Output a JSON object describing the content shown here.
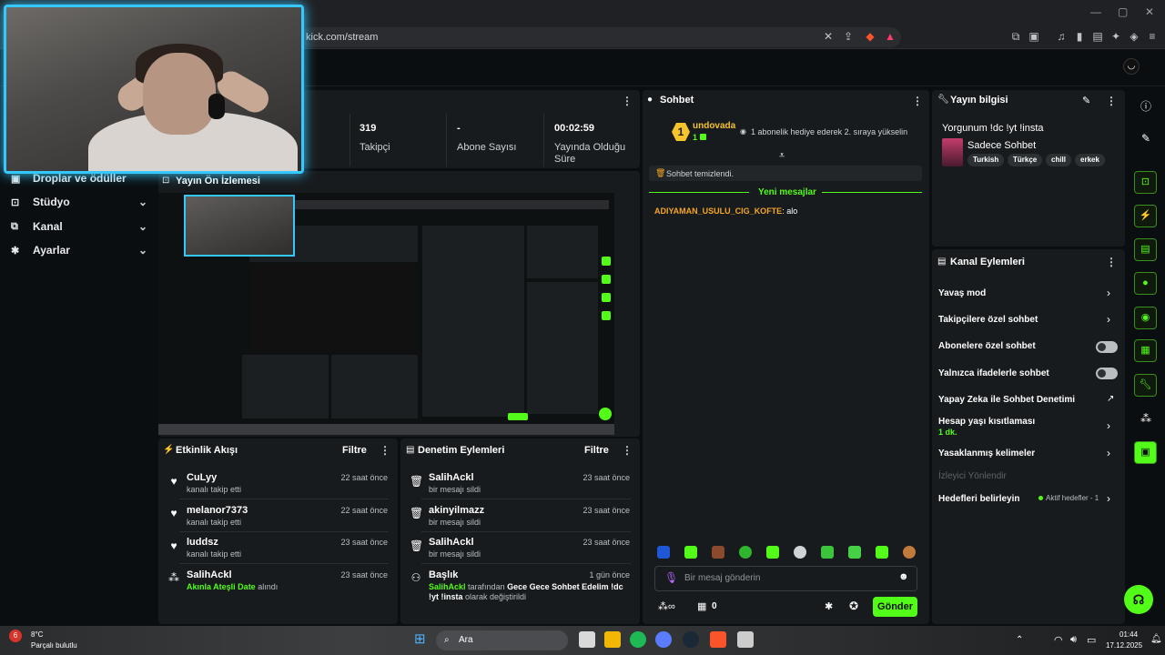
{
  "browser": {
    "url": "kick.com/stream",
    "window_controls": {
      "minimize": "—",
      "maximize": "▢",
      "close": "✕"
    }
  },
  "sidebar": {
    "items": [
      {
        "label": "Droplar ve ödüller",
        "icon": "gift-icon"
      },
      {
        "label": "Stüdyo",
        "icon": "studio-icon"
      },
      {
        "label": "Kanal",
        "icon": "channel-icon"
      },
      {
        "label": "Ayarlar",
        "icon": "gear-icon"
      }
    ]
  },
  "stats": [
    {
      "value": "319",
      "label": "Takipçi"
    },
    {
      "value": "-",
      "label": "Abone Sayısı"
    },
    {
      "value": "00:02:59",
      "label": "Yayında Olduğu Süre"
    }
  ],
  "preview": {
    "title": "Yayın Ön İzlemesi"
  },
  "activity": {
    "title": "Etkinlik Akışı",
    "filter": "Filtre",
    "items": [
      {
        "name": "CuLyy",
        "sub": "kanalı takip etti",
        "time": "22 saat önce",
        "icon": "heart-icon"
      },
      {
        "name": "melanor7373",
        "sub": "kanalı takip etti",
        "time": "22 saat önce",
        "icon": "heart-icon"
      },
      {
        "name": "luddsz",
        "sub": "kanalı takip etti",
        "time": "23 saat önce",
        "icon": "heart-icon"
      },
      {
        "name": "SalihAckl",
        "sub_highlight": "Akınla Ateşli Date",
        "sub_rest": "alındı",
        "time": "23 saat önce",
        "icon": "points-icon"
      }
    ]
  },
  "moderation": {
    "title": "Denetim Eylemleri",
    "filter": "Filtre",
    "items": [
      {
        "name": "SalihAckl",
        "sub": "bir mesajı sildi",
        "time": "23 saat önce",
        "icon": "trash-icon"
      },
      {
        "name": "akinyilmazz",
        "sub": "bir mesajı sildi",
        "time": "23 saat önce",
        "icon": "trash-icon"
      },
      {
        "name": "SalihAckl",
        "sub": "bir mesajı sildi",
        "time": "23 saat önce",
        "icon": "trash-icon"
      },
      {
        "name": "Başlık",
        "time": "1 gün önce",
        "icon": "user-edit-icon",
        "sub_user": "SalihAckl",
        "sub_mid": "tarafından",
        "sub_title": "Gece Gece Sohbet Edelim !dc !yt !insta",
        "sub_end": "olarak değiştirildi"
      }
    ]
  },
  "chat": {
    "title": "Sohbet",
    "leader_rank": "1",
    "leader_name": "undovada",
    "leader_count": "1",
    "gift_prompt": "1 abonelik hediye ederek 2. sıraya yükselin",
    "cleared": "Sohbet temizlendi.",
    "new_messages": "Yeni mesajlar",
    "messages": [
      {
        "user": "ADIYAMAN_USULU_CIG_KOFTE",
        "text": "alo",
        "user_color": "#f5a623"
      }
    ],
    "input_placeholder": "Bir mesaj gönderin",
    "points": "0",
    "send": "Gönder"
  },
  "stream_info": {
    "title_label": "Yayın bilgisi",
    "stream_title": "Yorgunum !dc !yt !insta",
    "category": "Sadece Sohbet",
    "tags": [
      "Turkish",
      "Türkçe",
      "chill",
      "erkek"
    ]
  },
  "channel_actions": {
    "title": "Kanal Eylemleri",
    "items": [
      {
        "label": "Yavaş mod",
        "control": "chevron"
      },
      {
        "label": "Takipçilere özel sohbet",
        "control": "chevron"
      },
      {
        "label": "Abonelere özel sohbet",
        "control": "toggle"
      },
      {
        "label": "Yalnızca ifadelerle sohbet",
        "control": "toggle"
      },
      {
        "label": "Yapay Zeka ile Sohbet Denetimi",
        "control": "external"
      },
      {
        "label": "Hesap yaşı kısıtlaması",
        "sub": "1 dk.",
        "control": "chevron"
      },
      {
        "label": "Yasaklanmış kelimeler",
        "control": "chevron"
      },
      {
        "label": "İzleyici Yönlendir",
        "control": "none",
        "disabled": true
      },
      {
        "label": "Hedefleri belirleyin",
        "status": "Aktif hedefler - 1",
        "control": "chevron"
      }
    ]
  },
  "taskbar": {
    "weather_temp": "8°C",
    "weather_desc": "Parçalı bulutlu",
    "search": "Ara",
    "time": "01:44",
    "date": "17.12.2025"
  },
  "colors": {
    "accent": "#53fc18",
    "webcam_border": "#35c8ff",
    "panel": "#181b1d",
    "background": "#0b0e10"
  }
}
